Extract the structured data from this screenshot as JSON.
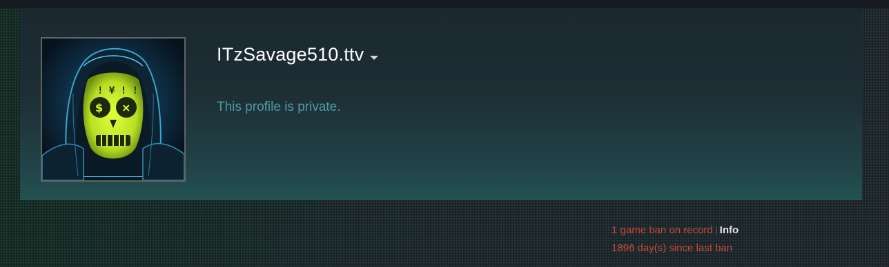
{
  "profile": {
    "persona_name": "ITzSavage510.ttv",
    "private_message": "This profile is private."
  },
  "ban_status": {
    "game_ban_text": "1 game ban on record",
    "separator": "|",
    "info_link": "Info",
    "days_since_text": "1896 day(s) since last ban"
  },
  "icons": {
    "dropdown": "chevron-down-icon",
    "avatar": "skull-mask-avatar"
  },
  "colors": {
    "name": "#ffffff",
    "private_text": "#4e9ba3",
    "ban_text": "#c94a3c",
    "info_link": "#e4e4e4"
  }
}
